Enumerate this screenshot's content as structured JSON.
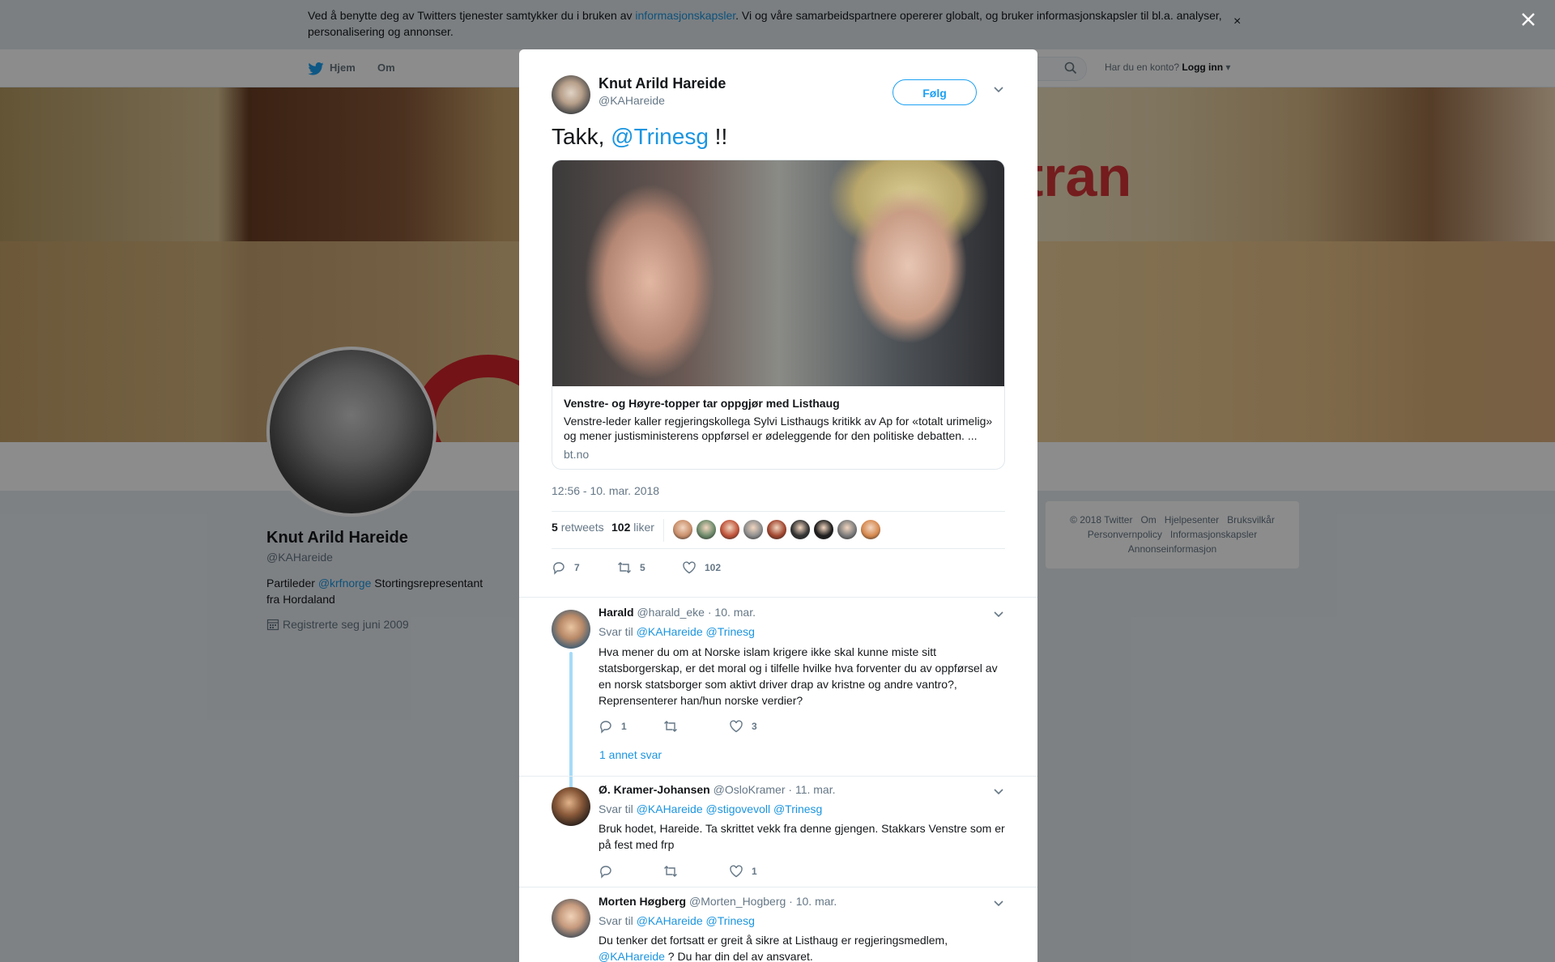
{
  "cookie_bar": {
    "text_before": "Ved å benytte deg av Twitters tjenester samtykker du i bruken av ",
    "link": "informasjonskapsler",
    "text_after": ". Vi og våre samarbeidspartnere opererer globalt, og bruker informasjonskapsler til bl.a. analyser, personalisering og annonser.",
    "close": "×"
  },
  "nav": {
    "home": "Hjem",
    "about": "Om",
    "login_prompt": "Har du en konto?",
    "login": "Logg inn"
  },
  "banner": {
    "word": "tran"
  },
  "profile": {
    "name": "Knut Arild Hareide",
    "handle": "@KAHareide",
    "bio_before": "Partileder ",
    "bio_link": "@krfnorge",
    "bio_after": " Stortingsrepresentant fra Hordaland",
    "joined": "Registrerte seg juni 2009"
  },
  "footer": {
    "links": [
      "© 2018 Twitter",
      "Om",
      "Hjelpesenter",
      "Bruksvilkår",
      "Personvernpolicy",
      "Informasjonskapsler",
      "Annonseinformasjon"
    ]
  },
  "tweet": {
    "author_name": "Knut Arild Hareide",
    "author_handle": "@KAHareide",
    "follow": "Følg",
    "text_before": "Takk, ",
    "mention": "@Trinesg",
    "text_after": " !!",
    "card": {
      "title": "Venstre- og Høyre-topper tar oppgjør med Listhaug",
      "description": "Venstre-leder kaller regjeringskollega Sylvi Listhaugs kritikk av Ap for «totalt urimelig» og mener justisministerens oppførsel er ødeleggende for den politiske debatten. ...",
      "domain": "bt.no"
    },
    "time": "12:56 - 10. mar. 2018",
    "retweets_count": "5",
    "retweets_label": "retweets",
    "likes_count": "102",
    "likes_label": "liker",
    "actions": {
      "replies": "7",
      "retweets": "5",
      "likes": "102"
    },
    "liker_colors": [
      "#c98f6b",
      "#6c8a6a",
      "#c0533a",
      "#8d8d8d",
      "#a1462f",
      "#333333",
      "#1e1e1e",
      "#7a7a7a",
      "#d6894f"
    ]
  },
  "replies": [
    {
      "name": "Harald",
      "handle": "@harald_eke",
      "date": "· 10. mar.",
      "reply_label": "Svar til",
      "mentions": "@KAHareide @Trinesg",
      "text": "Hva mener du om at Norske islam krigere ikke skal kunne miste sitt statsborgerskap, er det moral og i tilfelle hvilke hva forventer du av oppførsel av en norsk statsborger som aktivt driver drap av kristne og andre vantro?, Reprensenterer han/hun norske verdier?",
      "reply_count": "1",
      "retweet_count": "",
      "like_count": "3",
      "more": "1 annet svar"
    },
    {
      "name": "Ø. Kramer-Johansen",
      "handle": "@OsloKramer",
      "date": "· 11. mar.",
      "reply_label": "Svar til",
      "mentions": "@KAHareide @stigovevoll @Trinesg",
      "text": "Bruk hodet, Hareide. Ta skrittet vekk fra denne gjengen. Stakkars Venstre som er på fest med frp",
      "reply_count": "",
      "retweet_count": "",
      "like_count": "1"
    },
    {
      "name": "Morten Høgberg",
      "handle": "@Morten_Hogberg",
      "date": "· 10. mar.",
      "reply_label": "Svar til",
      "mentions": "@KAHareide @Trinesg",
      "text": "Du tenker det fortsatt er greit å sikre at Listhaug er regjeringsmedlem,",
      "text_link": "@KAHareide",
      "text_after": " ? Du har din del av ansvaret."
    }
  ]
}
